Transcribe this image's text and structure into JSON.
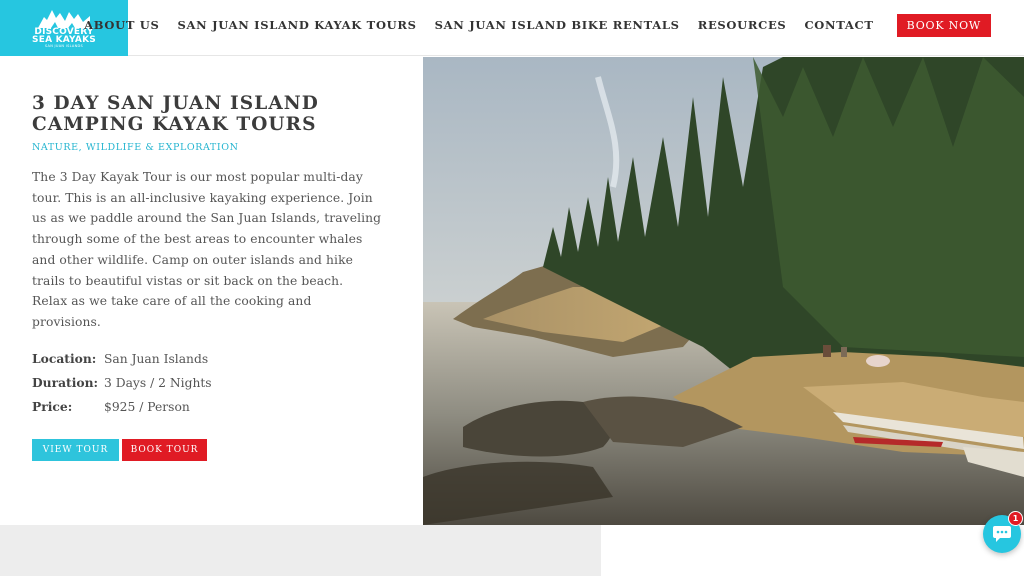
{
  "logo": {
    "line1": "Discovery",
    "line2": "Sea Kayaks",
    "tagline": "SAN JUAN ISLANDS"
  },
  "nav": {
    "items": [
      "ABOUT US",
      "SAN JUAN ISLAND KAYAK TOURS",
      "SAN JUAN ISLAND BIKE RENTALS",
      "RESOURCES",
      "CONTACT"
    ],
    "book_now": "BOOK NOW"
  },
  "tour": {
    "title_line1": "3 DAY SAN JUAN ISLAND",
    "title_line2": "CAMPING KAYAK TOURS",
    "subtitle": "NATURE, WILDLIFE & EXPLORATION",
    "description": "The 3 Day Kayak Tour is our most popular multi-day tour. This is an all-inclusive kayaking experience. Join us as we paddle around the San Juan Islands, traveling through some of the best areas to encounter whales and other wildlife. Camp on outer islands and hike trails to beautiful vistas or sit back on the beach. Relax as we take care of all the cooking and provisions.",
    "facts": [
      {
        "label": "Location:",
        "value": "San Juan Islands"
      },
      {
        "label": "Duration:",
        "value": "3 Days / 2 Nights"
      },
      {
        "label": "Price:",
        "value": "$925 / Person"
      }
    ],
    "view_tour": "VIEW TOUR",
    "book_tour": "BOOK TOUR"
  },
  "chat": {
    "badge": "1"
  },
  "colors": {
    "accent": "#26c6e0",
    "cta": "#e01b24"
  }
}
